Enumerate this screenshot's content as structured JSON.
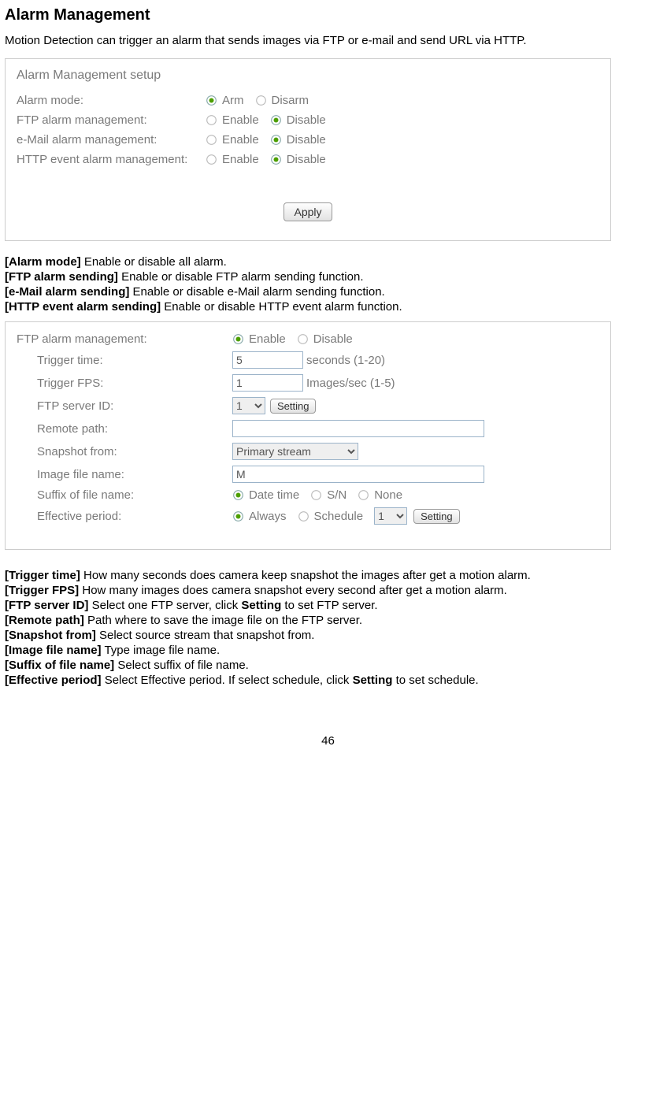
{
  "heading": "Alarm Management",
  "intro": "Motion Detection can trigger an alarm that sends images via FTP or e-mail and send URL via HTTP.",
  "panel1": {
    "title": "Alarm Management setup",
    "rows": {
      "alarm_mode": {
        "label": "Alarm mode:",
        "opt1": "Arm",
        "opt2": "Disarm",
        "selected": 1
      },
      "ftp": {
        "label": "FTP alarm management:",
        "opt1": "Enable",
        "opt2": "Disable",
        "selected": 2
      },
      "email": {
        "label": "e-Mail alarm management:",
        "opt1": "Enable",
        "opt2": "Disable",
        "selected": 2
      },
      "http": {
        "label": "HTTP event alarm management:",
        "opt1": "Enable",
        "opt2": "Disable",
        "selected": 2
      }
    },
    "apply": "Apply"
  },
  "desc1": [
    {
      "term": "[Alarm mode]",
      "text": " Enable or disable all alarm."
    },
    {
      "term": "[FTP alarm sending]",
      "text": " Enable or disable FTP alarm sending function."
    },
    {
      "term": "[e-Mail alarm sending]",
      "text": " Enable or disable e-Mail alarm sending function."
    },
    {
      "term": "[HTTP event alarm sending]",
      "text": " Enable or disable HTTP event alarm function."
    }
  ],
  "panel2": {
    "ftp_mgmt": {
      "label": "FTP alarm management:",
      "opt1": "Enable",
      "opt2": "Disable",
      "selected": 1
    },
    "trigger_time": {
      "label": "Trigger time:",
      "value": "5",
      "suffix": "seconds (1-20)"
    },
    "trigger_fps": {
      "label": "Trigger FPS:",
      "value": "1",
      "suffix": "Images/sec (1-5)"
    },
    "ftp_server": {
      "label": "FTP server ID:",
      "value": "1",
      "button": "Setting"
    },
    "remote_path": {
      "label": "Remote path:",
      "value": ""
    },
    "snapshot": {
      "label": "Snapshot from:",
      "value": "Primary stream"
    },
    "image_name": {
      "label": "Image file name:",
      "value": "M"
    },
    "suffix": {
      "label": "Suffix of file name:",
      "opt1": "Date time",
      "opt2": "S/N",
      "opt3": "None",
      "selected": 1
    },
    "effective": {
      "label": "Effective period:",
      "opt1": "Always",
      "opt2": "Schedule",
      "sched_value": "1",
      "button": "Setting",
      "selected": 1
    }
  },
  "desc2": [
    {
      "term": "[Trigger time]",
      "text": " How many seconds does camera keep snapshot the images after get a motion alarm."
    },
    {
      "term": "[Trigger FPS]",
      "text": " How many images does camera snapshot every second after get a motion alarm."
    },
    {
      "term": "[FTP server ID]",
      "text": " Select one FTP server, click ",
      "bold": "Setting",
      "after": " to set FTP server."
    },
    {
      "term": "[Remote path]",
      "text": " Path where to save the image file on the FTP server."
    },
    {
      "term": "[Snapshot from]",
      "text": " Select source stream that snapshot from."
    },
    {
      "term": "[Image file name]",
      "text": " Type image file name."
    },
    {
      "term": "[Suffix of file name]",
      "text": " Select suffix of file name."
    },
    {
      "term": "[Effective period]",
      "text": " Select Effective period. If select schedule, click ",
      "bold": "Setting",
      "after": " to set schedule."
    }
  ],
  "page_number": "46"
}
